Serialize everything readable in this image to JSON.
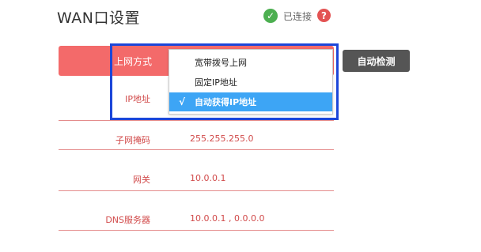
{
  "header": {
    "title": "WAN口设置",
    "status_icon": "check-circle-icon",
    "status_text": "已连接",
    "help_label": "?"
  },
  "connection_mode": {
    "label": "上网方式",
    "options": [
      {
        "label": "宽带拨号上网",
        "selected": false
      },
      {
        "label": "固定IP地址",
        "selected": false
      },
      {
        "label": "自动获得IP地址",
        "selected": true
      }
    ],
    "check_mark": "√"
  },
  "auto_detect_label": "自动检测",
  "fields": [
    {
      "label": "IP地址",
      "value": ""
    },
    {
      "label": "子网掩码",
      "value": "255.255.255.0"
    },
    {
      "label": "网关",
      "value": "10.0.0.1"
    },
    {
      "label": "DNS服务器",
      "value": "10.0.0.1 , 0.0.0.0"
    }
  ],
  "colors": {
    "accent_red": "#f36a6a",
    "field_text": "#d14a4a",
    "selected_option": "#3da5f5",
    "highlight_border": "#1b46d9",
    "ok_green": "#4caf50"
  }
}
